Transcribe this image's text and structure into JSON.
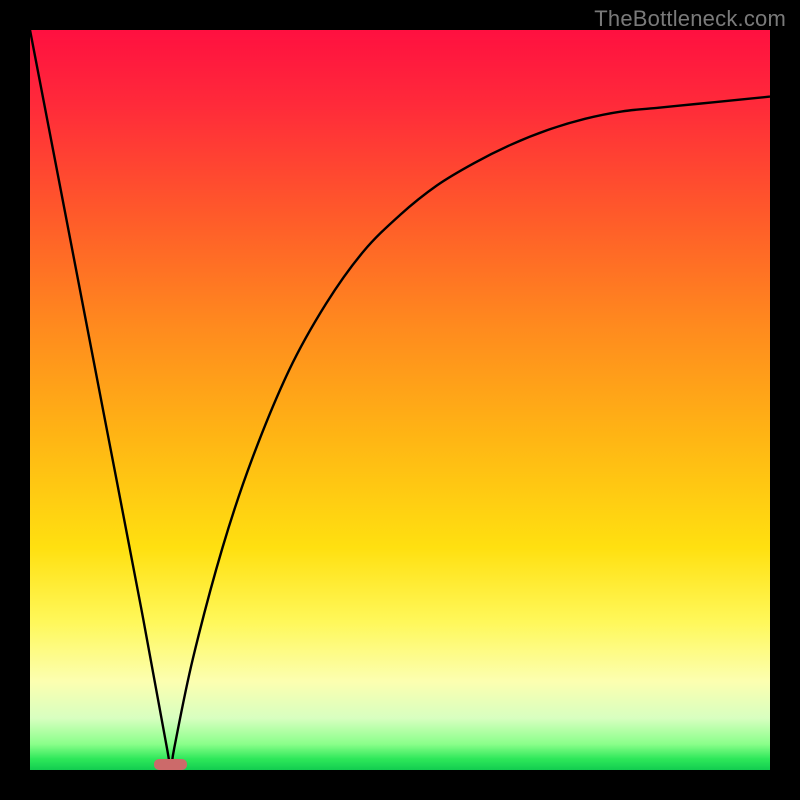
{
  "watermark": "TheBottleneck.com",
  "chart_data": {
    "type": "line",
    "title": "",
    "xlabel": "",
    "ylabel": "",
    "xlim": [
      0,
      1
    ],
    "ylim": [
      0,
      1
    ],
    "notes": "Background is a vertical red→yellow→green gradient. A single black curve plunges to near zero around x≈0.19 (the dip) and asymptotically rises toward ~0.91 on the right. A small rounded pink marker sits at the dip on the x-axis.",
    "dip_x": 0.19,
    "right_asymptote_y": 0.91,
    "curve_samples": {
      "x": [
        0.0,
        0.05,
        0.1,
        0.15,
        0.185,
        0.19,
        0.195,
        0.22,
        0.26,
        0.3,
        0.35,
        0.4,
        0.45,
        0.5,
        0.55,
        0.6,
        0.65,
        0.7,
        0.75,
        0.8,
        0.85,
        0.9,
        0.95,
        1.0
      ],
      "y": [
        1.0,
        0.74,
        0.48,
        0.22,
        0.03,
        0.0,
        0.03,
        0.15,
        0.3,
        0.42,
        0.54,
        0.63,
        0.7,
        0.75,
        0.79,
        0.82,
        0.845,
        0.865,
        0.88,
        0.89,
        0.895,
        0.9,
        0.905,
        0.91
      ]
    },
    "marker": {
      "x": 0.19,
      "y": 0.0,
      "width_frac": 0.045,
      "height_frac": 0.015,
      "color": "#cc6a6a"
    }
  },
  "colors": {
    "background": "#000000",
    "curve": "#000000",
    "marker": "#cc6a6a",
    "watermark": "#7a7a7a"
  }
}
